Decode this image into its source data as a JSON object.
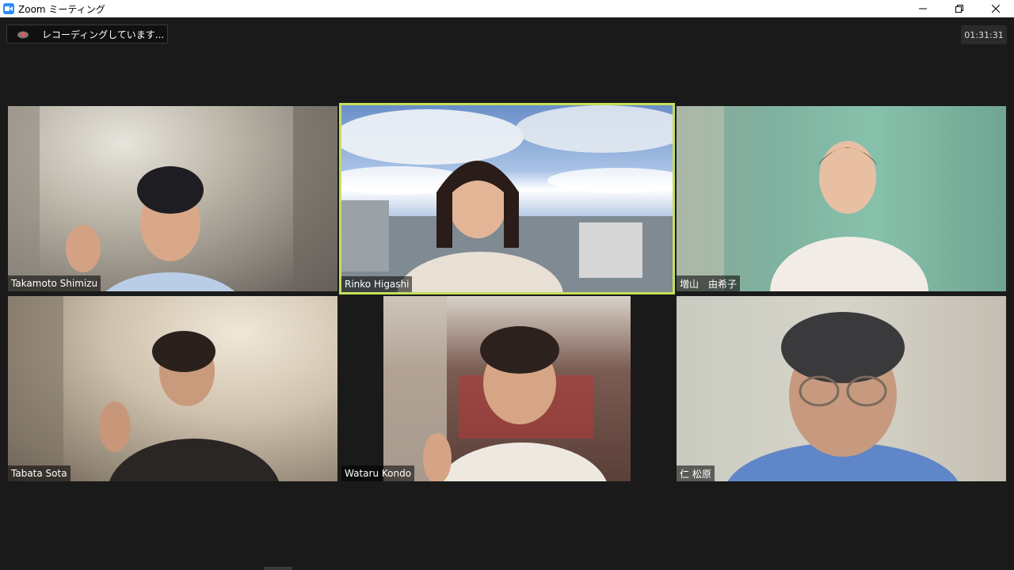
{
  "window": {
    "title": "Zoom ミーティング",
    "icon": "zoom-video-icon"
  },
  "recording": {
    "label": "レコーディングしています..."
  },
  "timer": {
    "value": "01:31:31"
  },
  "participants": [
    {
      "name": "Takamoto Shimizu"
    },
    {
      "name": "Rinko Higashi",
      "active_speaker": true
    },
    {
      "name": "増山　由希子"
    },
    {
      "name": "Tabata Sota"
    },
    {
      "name": "Wataru Kondo"
    },
    {
      "name": "仁 松原"
    }
  ],
  "colors": {
    "background": "#1a1a1a",
    "active_speaker_border": "#c5e05a",
    "zoom_blue": "#2d8cff",
    "recording_red": "#e05a5a"
  }
}
